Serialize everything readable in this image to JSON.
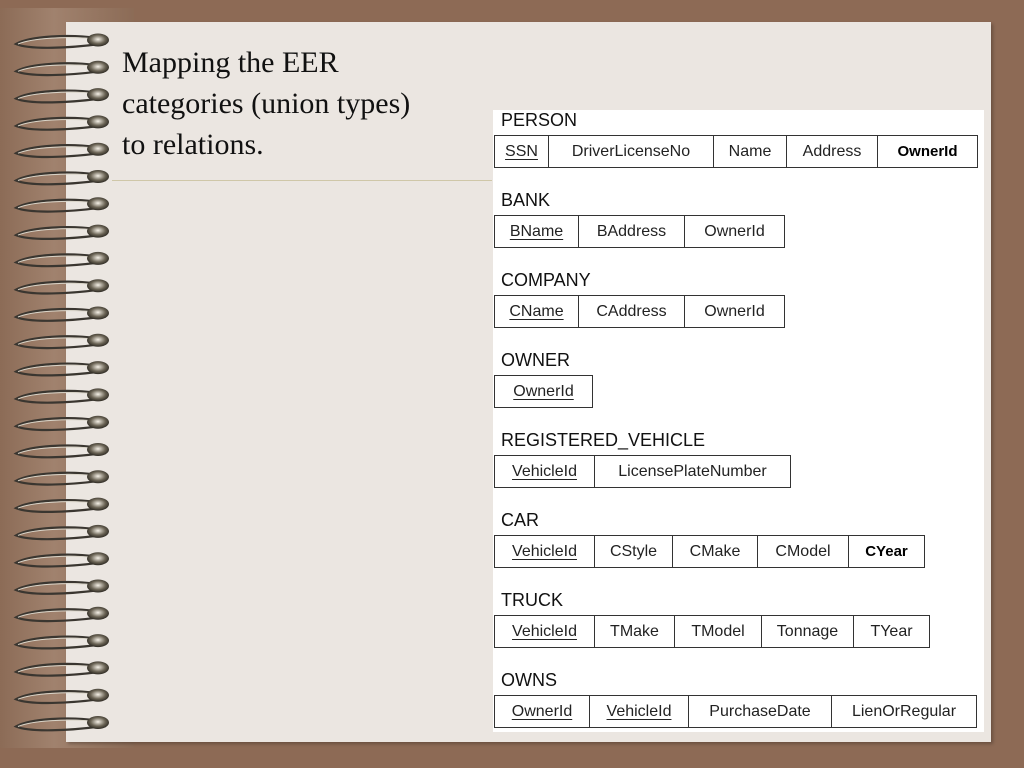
{
  "slide": {
    "title_lines": [
      "Mapping the EER",
      "categories (union types)",
      "to relations."
    ]
  },
  "relations": [
    {
      "name": "PERSON",
      "attributes": [
        {
          "label": "SSN",
          "key": true
        },
        {
          "label": "DriverLicenseNo",
          "key": false
        },
        {
          "label": "Name",
          "key": false
        },
        {
          "label": "Address",
          "key": false
        },
        {
          "label": "OwnerId",
          "key": false,
          "bold": true
        }
      ]
    },
    {
      "name": "BANK",
      "attributes": [
        {
          "label": "BName",
          "key": true
        },
        {
          "label": "BAddress",
          "key": false
        },
        {
          "label": "OwnerId",
          "key": false
        }
      ]
    },
    {
      "name": "COMPANY",
      "attributes": [
        {
          "label": "CName",
          "key": true
        },
        {
          "label": "CAddress",
          "key": false
        },
        {
          "label": "OwnerId",
          "key": false
        }
      ]
    },
    {
      "name": "OWNER",
      "attributes": [
        {
          "label": "OwnerId",
          "key": true
        }
      ]
    },
    {
      "name": "REGISTERED_VEHICLE",
      "attributes": [
        {
          "label": "VehicleId",
          "key": true
        },
        {
          "label": "LicensePlateNumber",
          "key": false
        }
      ]
    },
    {
      "name": "CAR",
      "attributes": [
        {
          "label": "VehicleId",
          "key": true
        },
        {
          "label": "CStyle",
          "key": false
        },
        {
          "label": "CMake",
          "key": false
        },
        {
          "label": "CModel",
          "key": false
        },
        {
          "label": "CYear",
          "key": false,
          "bold": true
        }
      ]
    },
    {
      "name": "TRUCK",
      "attributes": [
        {
          "label": "VehicleId",
          "key": true
        },
        {
          "label": "TMake",
          "key": false
        },
        {
          "label": "TModel",
          "key": false
        },
        {
          "label": "Tonnage",
          "key": false
        },
        {
          "label": "TYear",
          "key": false
        }
      ]
    },
    {
      "name": "OWNS",
      "attributes": [
        {
          "label": "OwnerId",
          "key": true
        },
        {
          "label": "VehicleId",
          "key": true
        },
        {
          "label": "PurchaseDate",
          "key": false
        },
        {
          "label": "LienOrRegular",
          "key": false
        }
      ]
    }
  ],
  "colors": {
    "background": "#8d6a55",
    "paper": "#ebe6e1",
    "schema_panel": "#ffffff"
  }
}
